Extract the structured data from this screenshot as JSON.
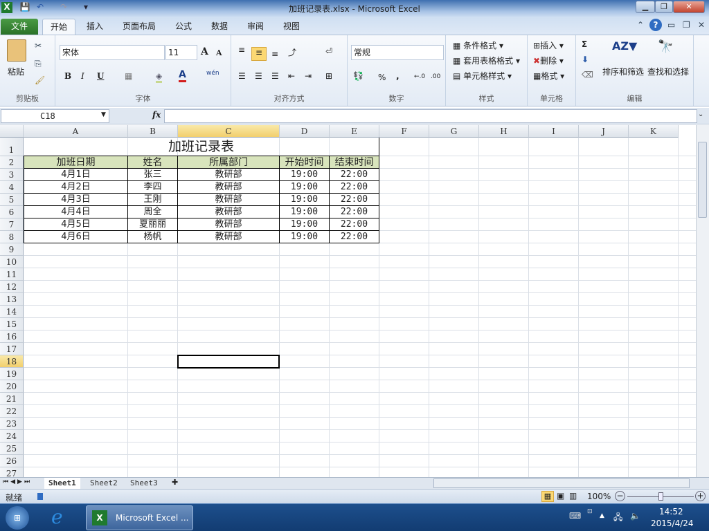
{
  "window": {
    "title": "加班记录表.xlsx - Microsoft Excel",
    "min": "▁",
    "max": "❐",
    "close": "✕"
  },
  "tabs": [
    "文件",
    "开始",
    "插入",
    "页面布局",
    "公式",
    "数据",
    "审阅",
    "视图"
  ],
  "ribbon": {
    "clipboard": {
      "paste": "粘贴",
      "label": "剪贴板"
    },
    "font": {
      "name": "宋体",
      "size": "11",
      "bold": "B",
      "italic": "I",
      "underline": "U",
      "grow": "A",
      "shrink": "A",
      "phonetic": "wén",
      "label": "字体"
    },
    "alignment": {
      "label": "对齐方式"
    },
    "number": {
      "format": "常规",
      "percent": "%",
      "comma": ",",
      "inc": "←.0",
      "dec": ".00",
      "label": "数字"
    },
    "styles": {
      "conditional": "条件格式",
      "table": "套用表格格式",
      "cell": "单元格样式",
      "label": "样式"
    },
    "cells": {
      "insert": "插入",
      "delete": "删除",
      "format": "格式",
      "label": "单元格"
    },
    "editing": {
      "sum": "Σ",
      "sort": "排序和筛选",
      "find": "查找和选择",
      "label": "编辑"
    }
  },
  "formula": {
    "namebox": "C18",
    "fx": "fx",
    "value": ""
  },
  "columns": [
    "A",
    "B",
    "C",
    "D",
    "E",
    "F",
    "G",
    "H",
    "I",
    "J",
    "K"
  ],
  "selected_column": "C",
  "selected_row": 18,
  "sheet": {
    "title": "加班记录表",
    "headers": [
      "加班日期",
      "姓名",
      "所属部门",
      "开始时间",
      "结束时间"
    ],
    "rows": [
      [
        "4月1日",
        "张三",
        "教研部",
        "19:00",
        "22:00"
      ],
      [
        "4月2日",
        "李四",
        "教研部",
        "19:00",
        "22:00"
      ],
      [
        "4月3日",
        "王刚",
        "教研部",
        "19:00",
        "22:00"
      ],
      [
        "4月4日",
        "周全",
        "教研部",
        "19:00",
        "22:00"
      ],
      [
        "4月5日",
        "夏丽丽",
        "教研部",
        "19:00",
        "22:00"
      ],
      [
        "4月6日",
        "杨帆",
        "教研部",
        "19:00",
        "22:00"
      ]
    ],
    "header_fill": "#d8e4bc"
  },
  "sheet_tabs": [
    "Sheet1",
    "Sheet2",
    "Sheet3"
  ],
  "status": {
    "ready": "就绪",
    "zoom": "100%",
    "zoom_fraction": 0.5
  },
  "taskbar": {
    "app": "Microsoft Excel ...",
    "time": "14:52",
    "date": "2015/4/24"
  }
}
